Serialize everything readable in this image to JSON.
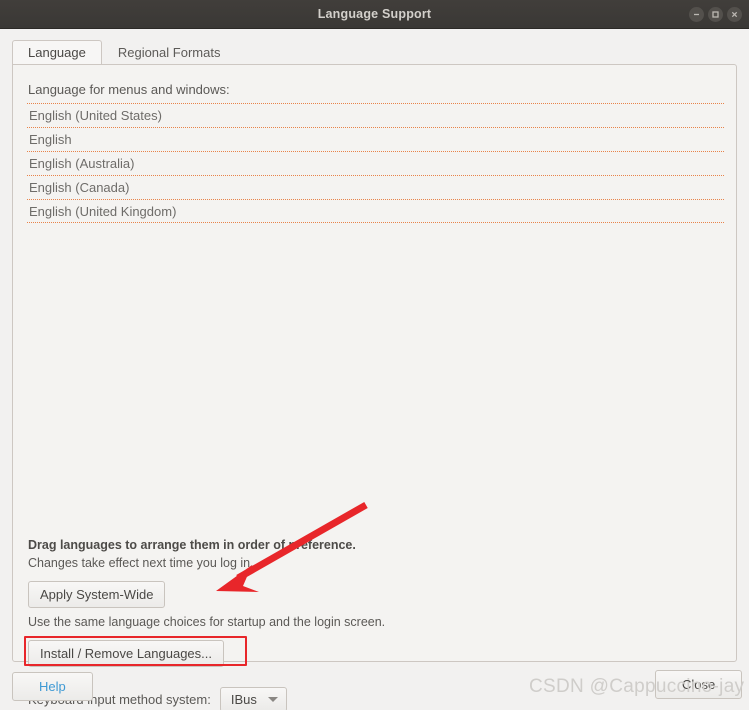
{
  "window": {
    "title": "Language Support",
    "controls": [
      {
        "name": "minimize",
        "glyph": "minimize-icon"
      },
      {
        "name": "maximize",
        "glyph": "maximize-icon"
      },
      {
        "name": "close",
        "glyph": "close-icon"
      }
    ]
  },
  "tabs": [
    {
      "label": "Language",
      "active": true
    },
    {
      "label": "Regional Formats",
      "active": false
    }
  ],
  "main": {
    "list_label": "Language for menus and windows:",
    "languages": [
      "English (United States)",
      "English",
      "English (Australia)",
      "English (Canada)",
      "English (United Kingdom)"
    ],
    "hint_drag": "Drag languages to arrange them in order of preference.",
    "hint_changes": "Changes take effect next time you log in.",
    "apply_button": "Apply System-Wide",
    "hint_same_choices": "Use the same language choices for startup and the login screen.",
    "install_button": "Install / Remove Languages...",
    "keyboard_label": "Keyboard input method system:",
    "keyboard_value": "IBus"
  },
  "footer": {
    "help_button": "Help",
    "close_button": "Close"
  },
  "annotations": {
    "highlight_color": "#e8262a",
    "arrow_color": "#e8262a",
    "watermark": "CSDN @Cappuccino-jay"
  }
}
